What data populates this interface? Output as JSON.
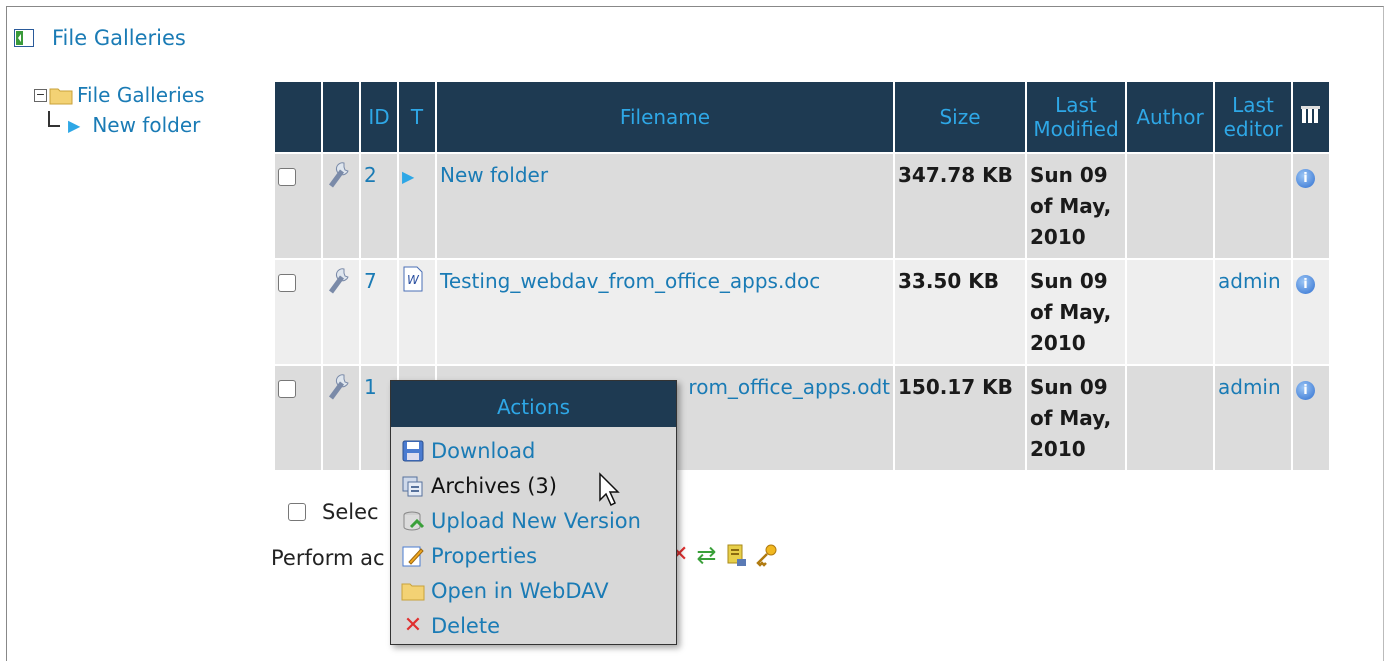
{
  "header": {
    "title": "File Galleries"
  },
  "tree": {
    "root": "File Galleries",
    "child": "New folder"
  },
  "table": {
    "columns": [
      "",
      "",
      "ID",
      "T",
      "Filename",
      "Size",
      "Last Modified",
      "Author",
      "Last editor",
      ""
    ],
    "col_last_modified_1": "Last",
    "col_last_modified_2": "Modified",
    "col_last_editor_1": "Last",
    "col_last_editor_2": "editor",
    "rows": [
      {
        "id": "2",
        "filename": "New folder",
        "size": "347.78 KB",
        "mod1": "Sun 09",
        "mod2": "of May,",
        "mod3": "2010",
        "author": "",
        "editor": ""
      },
      {
        "id": "7",
        "filename": "Testing_webdav_from_office_apps.doc",
        "size": "33.50 KB",
        "mod1": "Sun 09",
        "mod2": "of May,",
        "mod3": "2010",
        "author": "",
        "editor": "admin"
      },
      {
        "id": "1",
        "filename": "rom_office_apps.odt",
        "size": "150.17 KB",
        "mod1": "Sun 09",
        "mod2": "of May,",
        "mod3": "2010",
        "author": "",
        "editor": "admin"
      }
    ]
  },
  "select_label": "Selec",
  "perform_label": "Perform ac",
  "menu": {
    "title": "Actions",
    "items": [
      "Download",
      "Archives (3)",
      "Upload New Version",
      "Properties",
      "Open in WebDAV",
      "Delete"
    ]
  },
  "colors": {
    "header_bg": "#1e3a52",
    "link": "#1a7bb5",
    "header_text": "#2ea7e6"
  }
}
